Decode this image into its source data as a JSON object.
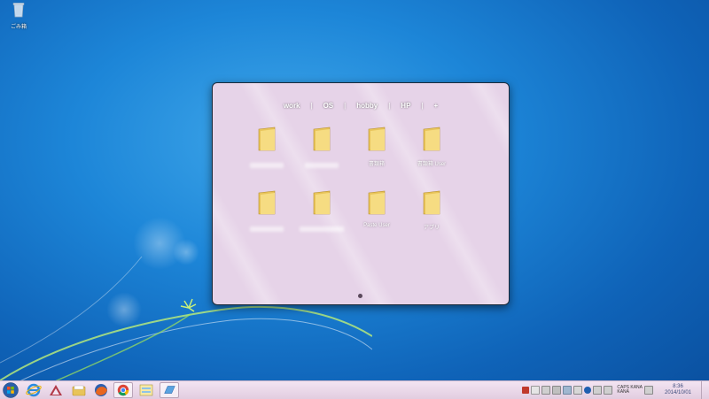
{
  "desktop": {
    "recycle_bin_label": "ごみ箱"
  },
  "panel": {
    "tabs": [
      {
        "label": "work"
      },
      {
        "label": "OS"
      },
      {
        "label": "hobby"
      },
      {
        "label": "HP"
      },
      {
        "label": "+"
      }
    ],
    "separator": "|",
    "folders": [
      {
        "name": "",
        "icon": "folder-icon"
      },
      {
        "name": "",
        "icon": "folder-icon"
      },
      {
        "name": "書類箱",
        "icon": "folder-icon"
      },
      {
        "name": "書類箱 User",
        "icon": "folder-icon"
      },
      {
        "name": "",
        "icon": "folder-icon"
      },
      {
        "name": "",
        "icon": "folder-icon"
      },
      {
        "name": "Paste User",
        "icon": "folder-icon"
      },
      {
        "name": "アプリ",
        "icon": "folder-icon"
      }
    ],
    "page_indicator": {
      "current": 1,
      "total": 1
    }
  },
  "taskbar": {
    "buttons": [
      {
        "icon": "ie-icon"
      },
      {
        "icon": "app-icon"
      },
      {
        "icon": "explorer-icon"
      },
      {
        "icon": "firefox-icon"
      },
      {
        "icon": "chrome-icon"
      },
      {
        "icon": "widget-icon"
      },
      {
        "icon": "window-icon"
      }
    ],
    "tray": {
      "time": "8:36",
      "date": "2014/10/01",
      "lang_line1": "CAPS KANA",
      "lang_line2": "KANA"
    }
  },
  "colors": {
    "panel_bg": "#e6d3e8",
    "taskbar_bg": "#ead8e9",
    "desktop_blue": "#1d86d8"
  }
}
